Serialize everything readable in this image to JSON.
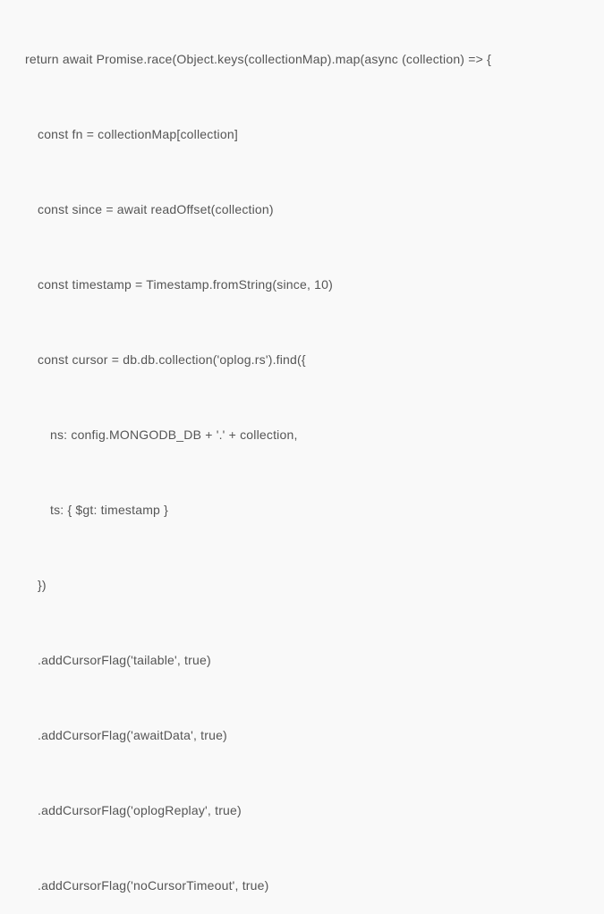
{
  "code": {
    "lines": [
      {
        "text": "return await Promise.race(Object.keys(collectionMap).map(async (collection) => {",
        "indent": 0
      },
      {
        "text": "const fn = collectionMap[collection]",
        "indent": 1
      },
      {
        "text": "const since = await readOffset(collection)",
        "indent": 1
      },
      {
        "text": "const timestamp = Timestamp.fromString(since, 10)",
        "indent": 1
      },
      {
        "text": "const cursor = db.db.collection('oplog.rs').find({",
        "indent": 1
      },
      {
        "text": "ns: config.MONGODB_DB + '.' + collection,",
        "indent": 2
      },
      {
        "text": "ts: { $gt: timestamp }",
        "indent": 2
      },
      {
        "text": "})",
        "indent": 1
      },
      {
        "text": ".addCursorFlag('tailable', true)",
        "indent": 1
      },
      {
        "text": ".addCursorFlag('awaitData', true)",
        "indent": 1
      },
      {
        "text": ".addCursorFlag('oplogReplay', true)",
        "indent": 1
      },
      {
        "text": ".addCursorFlag('noCursorTimeout', true)",
        "indent": 1
      }
    ]
  }
}
